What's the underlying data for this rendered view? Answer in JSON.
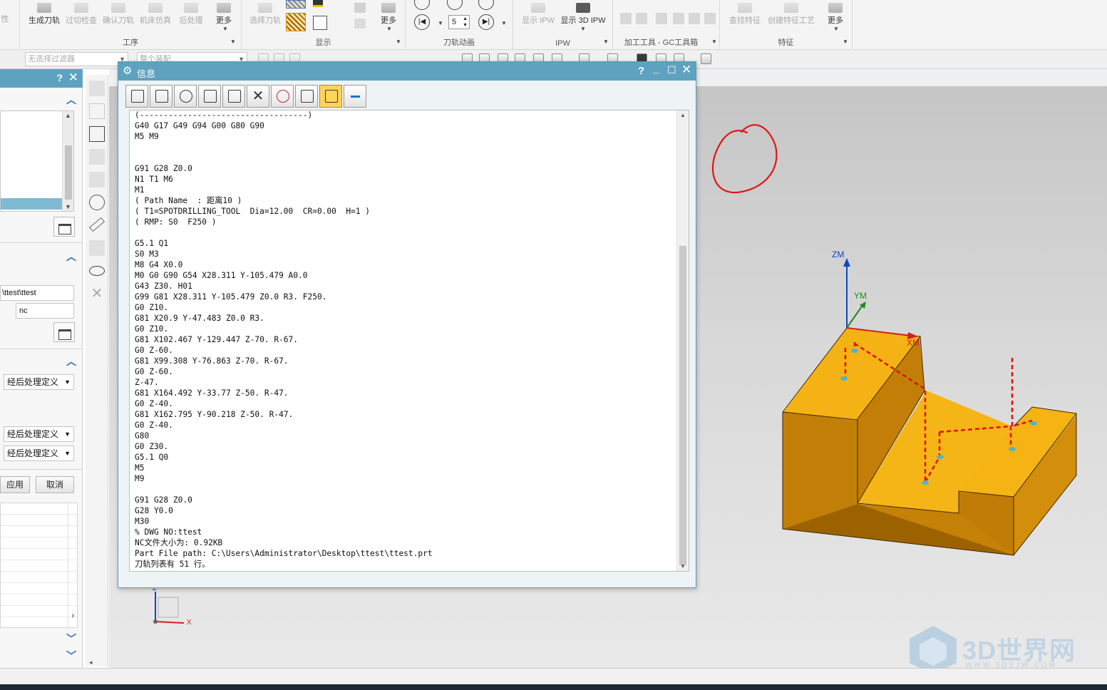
{
  "ribbon": {
    "groups": [
      {
        "label": "工序",
        "buttons": [
          {
            "label": "生成刀轨",
            "dim": false
          },
          {
            "label": "过切检查",
            "dim": true
          },
          {
            "label": "确认刀轨",
            "dim": true
          },
          {
            "label": "机床仿真",
            "dim": true
          },
          {
            "label": "后处理",
            "dim": true
          },
          {
            "label": "更多",
            "dim": false
          }
        ]
      },
      {
        "label": "显示",
        "buttons": [
          {
            "label": "选择刀轨",
            "dim": true
          },
          {
            "label": "更多",
            "dim": false
          }
        ]
      },
      {
        "label": "刀轨动画",
        "spinner_value": "5"
      },
      {
        "label": "IPW",
        "buttons": [
          {
            "label": "显示 IPW",
            "dim": true
          },
          {
            "label": "显示 3D IPW",
            "dim": false
          }
        ]
      },
      {
        "label": "加工工具 - GC工具箱"
      },
      {
        "label": "特征",
        "buttons": [
          {
            "label": "查找特征",
            "dim": true
          },
          {
            "label": "创建特征工艺",
            "dim": true
          },
          {
            "label": "更多",
            "dim": false
          }
        ]
      }
    ],
    "left_fragment": "性"
  },
  "filterbar": {
    "filter_placeholder": "无选择过滤器",
    "assembly_placeholder": "整个装配"
  },
  "left_panel": {
    "help": "?",
    "close": "✕",
    "output_path": "\\ttest\\ttest",
    "extension": "nc",
    "selects": [
      "经后处理定义",
      "经后处理定义",
      "经后处理定义"
    ],
    "apply_label": "应用",
    "cancel_label": "取消"
  },
  "info_dialog": {
    "title": "信息",
    "help": "?",
    "content": "(-----------------------------------)\nG40 G17 G49 G94 G00 G80 G90\nM5 M9\n\n\nG91 G28 Z0.0\nN1 T1 M6\nM1\n( Path Name  : 距离10 )\n( T1=SPOTDRILLING_TOOL  Dia=12.00  CR=0.00  H=1 )\n( RMP: S0  F250 )\n\nG5.1 Q1\nS0 M3\nM8 G4 X0.0\nM0 G0 G90 G54 X28.311 Y-105.479 A0.0\nG43 Z30. H01\nG99 G81 X28.311 Y-105.479 Z0.0 R3. F250.\nG0 Z10.\nG81 X20.9 Y-47.483 Z0.0 R3.\nG0 Z10.\nG81 X102.467 Y-129.447 Z-70. R-67.\nG0 Z-60.\nG81 X99.308 Y-76.863 Z-70. R-67.\nG0 Z-60.\nZ-47.\nG81 X164.492 Y-33.77 Z-50. R-47.\nG0 Z-40.\nG81 X162.795 Y-90.218 Z-50. R-47.\nG0 Z-40.\nG80\nG0 Z30.\nG5.1 Q0\nM5\nM9\n\nG91 G28 Z0.0\nG28 Y0.0\nM30\n% DWG NO:ttest\nNC文件大小为: 0.92KB\nPart File path: C:\\Users\\Administrator\\Desktop\\ttest\\ttest.prt\n刀轨列表有 51 行。"
  },
  "viewport": {
    "axes": {
      "zm": "ZM",
      "ym": "YM",
      "xm": "XM"
    },
    "triad": {
      "z": "Z",
      "x": "X"
    },
    "part_color": "#f5b20f",
    "toolpath_color": "#e01010",
    "annotation_color": "#e01515"
  },
  "watermark": {
    "name": "3D世界网",
    "url": "WWW.3DSJW.COM"
  }
}
